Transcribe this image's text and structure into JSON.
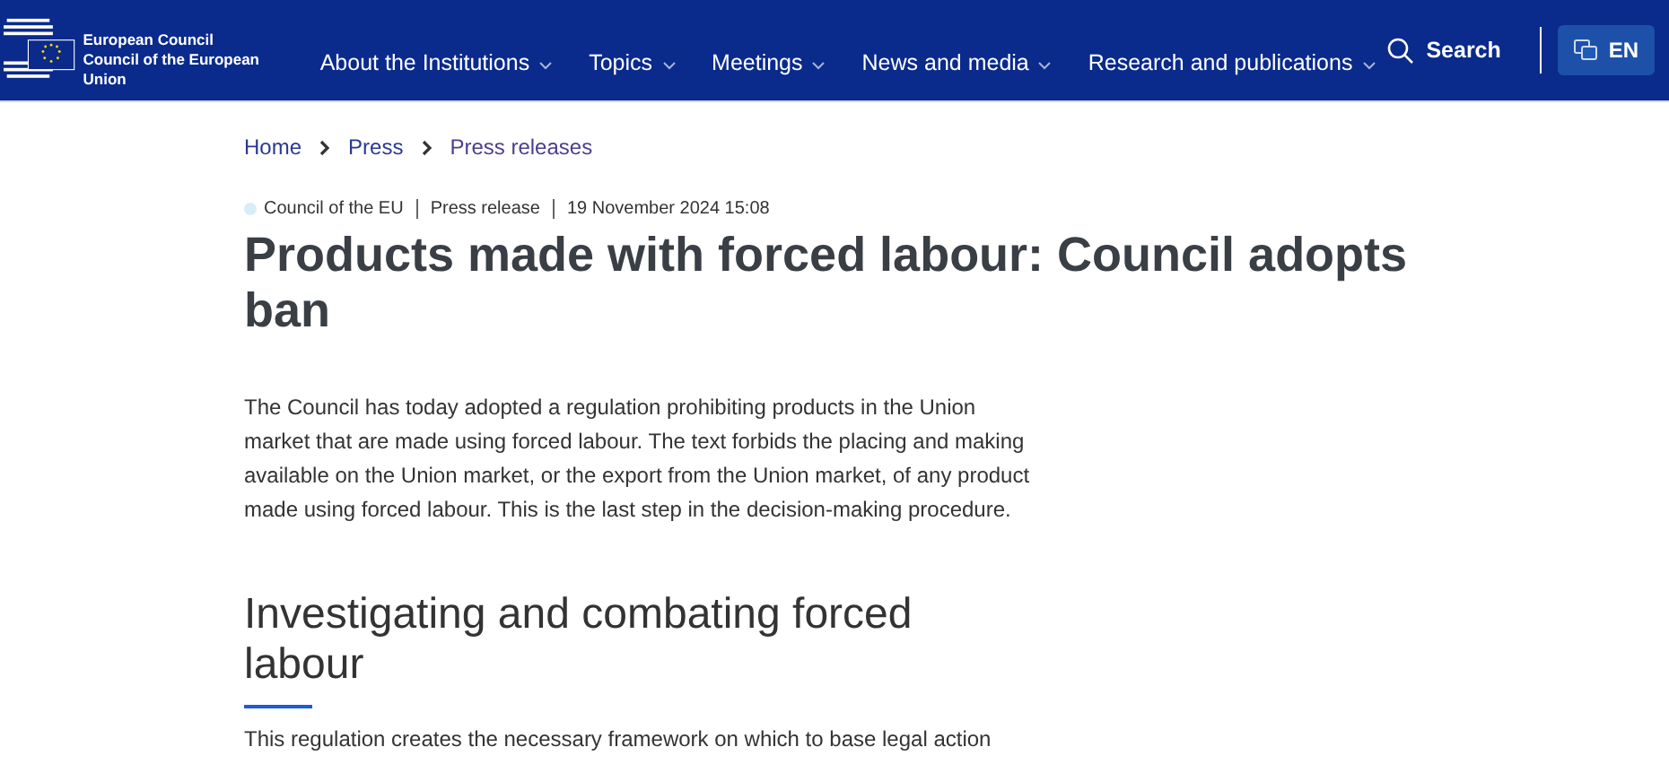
{
  "header": {
    "logo_lines": [
      "European Council",
      "Council of the European Union"
    ],
    "nav": [
      {
        "label": "About the Institutions"
      },
      {
        "label": "Topics"
      },
      {
        "label": "Meetings"
      },
      {
        "label": "News and media"
      },
      {
        "label": "Research and publications"
      }
    ],
    "search": "Search",
    "language": "EN"
  },
  "breadcrumb": [
    "Home",
    "Press",
    "Press releases"
  ],
  "meta": [
    "Council of the EU",
    "Press release",
    "19 November 2024 15:08"
  ],
  "title": "Products made with forced labour: Council adopts ban",
  "intro": "The Council has today adopted a regulation prohibiting products in the Union market that are made using forced labour. The text forbids the placing and making available on the Union market, or the export from the Union market, of any product made using forced labour. This is the last step in the decision-making procedure.",
  "section": {
    "heading": "Investigating and combating forced labour",
    "text": "This regulation creates the necessary framework on which to base legal action"
  }
}
